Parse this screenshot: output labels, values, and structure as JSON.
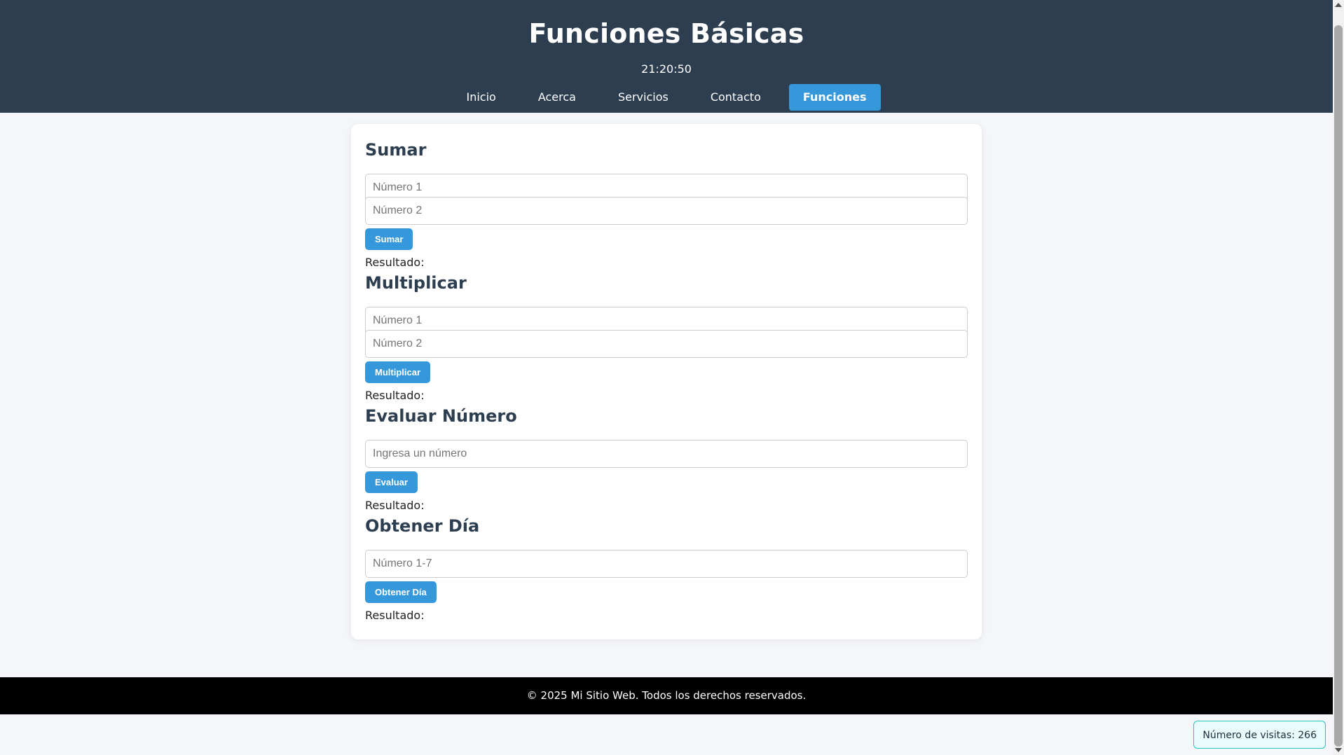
{
  "header": {
    "title": "Funciones Básicas",
    "clock": "21:20:50"
  },
  "nav": {
    "items": [
      "Inicio",
      "Acerca",
      "Servicios",
      "Contacto",
      "Funciones"
    ],
    "active": "Funciones"
  },
  "sections": {
    "sumar": {
      "title": "Sumar",
      "input1_placeholder": "Número 1",
      "input2_placeholder": "Número 2",
      "button": "Sumar",
      "result": "Resultado:"
    },
    "multiplicar": {
      "title": "Multiplicar",
      "input1_placeholder": "Número 1",
      "input2_placeholder": "Número 2",
      "button": "Multiplicar",
      "result": "Resultado:"
    },
    "evaluar": {
      "title": "Evaluar Número",
      "input_placeholder": "Ingresa un número",
      "button": "Evaluar",
      "result": "Resultado:"
    },
    "dia": {
      "title": "Obtener Día",
      "input_placeholder": "Número 1-7",
      "button": "Obtener Día",
      "result": "Resultado:"
    }
  },
  "footer": {
    "text": "© 2025 Mi Sitio Web. Todos los derechos reservados."
  },
  "visits": {
    "text": "Número de visitas: 266"
  },
  "colors": {
    "header_bg": "#2d3e50",
    "accent": "#3498db",
    "footer_bg": "#000000"
  }
}
